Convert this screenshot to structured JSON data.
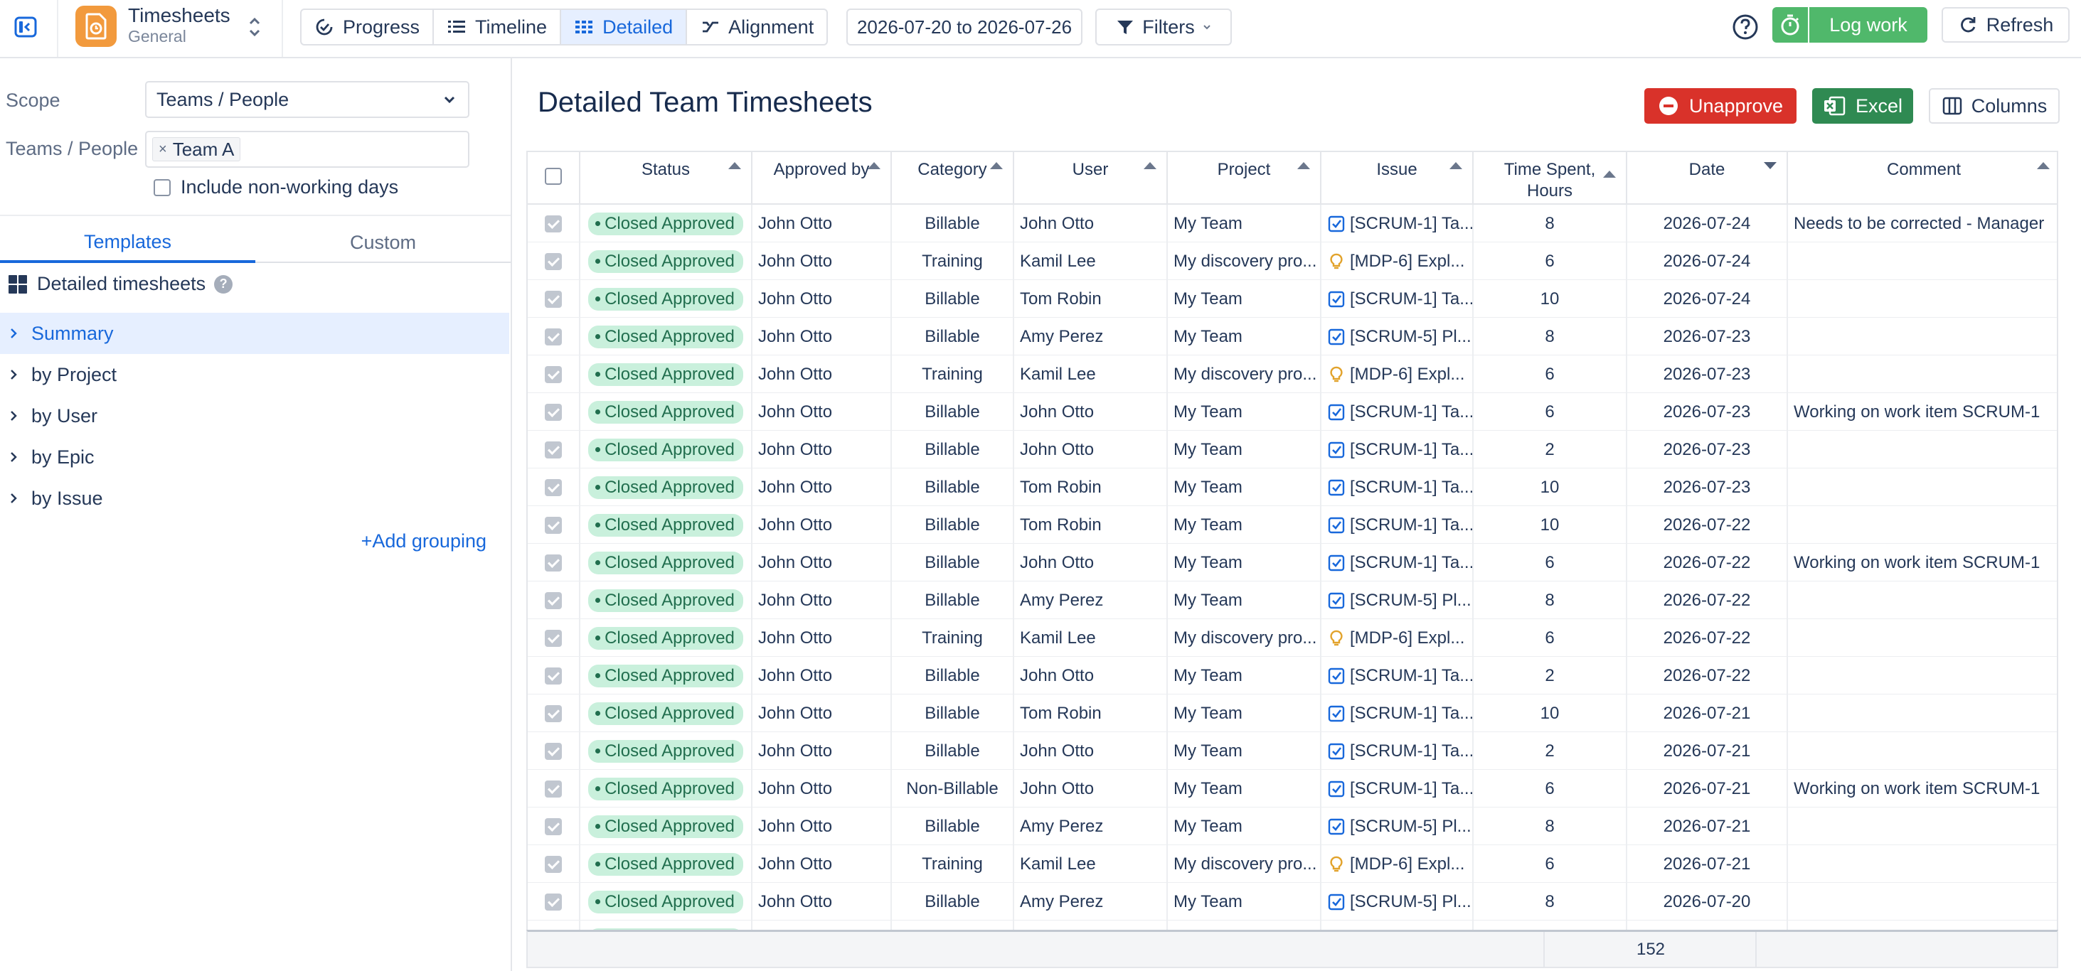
{
  "app": {
    "title": "Timesheets",
    "subtitle": "General"
  },
  "view_tabs": [
    {
      "label": "Progress",
      "icon": "progress-icon",
      "active": false
    },
    {
      "label": "Timeline",
      "icon": "timeline-icon",
      "active": false
    },
    {
      "label": "Detailed",
      "icon": "grid-icon",
      "active": true
    },
    {
      "label": "Alignment",
      "icon": "alignment-icon",
      "active": false
    }
  ],
  "date_range": "2026-07-20 to 2026-07-26",
  "filters_label": "Filters",
  "log_work_label": "Log work",
  "refresh_label": "Refresh",
  "sidebar": {
    "scope_label": "Scope",
    "scope_value": "Teams / People",
    "teams_label": "Teams / People",
    "team_chip": "Team A",
    "chip_remove": "×",
    "non_working_label": "Include non-working days",
    "tabs": [
      "Templates",
      "Custom"
    ],
    "template_title": "Detailed timesheets",
    "help_glyph": "?",
    "tree": [
      "Summary",
      "by Project",
      "by User",
      "by Epic",
      "by Issue"
    ],
    "add_grouping": "+Add grouping"
  },
  "main": {
    "title": "Detailed Team Timesheets",
    "unapprove_label": "Unapprove",
    "excel_label": "Excel",
    "columns_label": "Columns"
  },
  "table": {
    "headers": [
      "Status",
      "Approved by",
      "Category",
      "User",
      "Project",
      "Issue",
      "Time Spent, Hours",
      "Date",
      "Comment"
    ],
    "rows": [
      {
        "status": "Closed Approved",
        "approved_by": "John Otto",
        "category": "Billable",
        "user": "John Otto",
        "project": "My Team",
        "issue_type": "task",
        "issue": "[SCRUM-1] Ta...",
        "hours": "8",
        "date": "2026-07-24",
        "comment": "Needs to be corrected - Manager"
      },
      {
        "status": "Closed Approved",
        "approved_by": "John Otto",
        "category": "Training",
        "user": "Kamil Lee",
        "project": "My discovery pro...",
        "issue_type": "idea",
        "issue": "[MDP-6] Expl...",
        "hours": "6",
        "date": "2026-07-24",
        "comment": ""
      },
      {
        "status": "Closed Approved",
        "approved_by": "John Otto",
        "category": "Billable",
        "user": "Tom Robin",
        "project": "My Team",
        "issue_type": "task",
        "issue": "[SCRUM-1] Ta...",
        "hours": "10",
        "date": "2026-07-24",
        "comment": ""
      },
      {
        "status": "Closed Approved",
        "approved_by": "John Otto",
        "category": "Billable",
        "user": "Amy Perez",
        "project": "My Team",
        "issue_type": "task",
        "issue": "[SCRUM-5] Pl...",
        "hours": "8",
        "date": "2026-07-23",
        "comment": ""
      },
      {
        "status": "Closed Approved",
        "approved_by": "John Otto",
        "category": "Training",
        "user": "Kamil Lee",
        "project": "My discovery pro...",
        "issue_type": "idea",
        "issue": "[MDP-6] Expl...",
        "hours": "6",
        "date": "2026-07-23",
        "comment": ""
      },
      {
        "status": "Closed Approved",
        "approved_by": "John Otto",
        "category": "Billable",
        "user": "John Otto",
        "project": "My Team",
        "issue_type": "task",
        "issue": "[SCRUM-1] Ta...",
        "hours": "6",
        "date": "2026-07-23",
        "comment": "Working on work item SCRUM-1"
      },
      {
        "status": "Closed Approved",
        "approved_by": "John Otto",
        "category": "Billable",
        "user": "John Otto",
        "project": "My Team",
        "issue_type": "task",
        "issue": "[SCRUM-1] Ta...",
        "hours": "2",
        "date": "2026-07-23",
        "comment": ""
      },
      {
        "status": "Closed Approved",
        "approved_by": "John Otto",
        "category": "Billable",
        "user": "Tom Robin",
        "project": "My Team",
        "issue_type": "task",
        "issue": "[SCRUM-1] Ta...",
        "hours": "10",
        "date": "2026-07-23",
        "comment": ""
      },
      {
        "status": "Closed Approved",
        "approved_by": "John Otto",
        "category": "Billable",
        "user": "Tom Robin",
        "project": "My Team",
        "issue_type": "task",
        "issue": "[SCRUM-1] Ta...",
        "hours": "10",
        "date": "2026-07-22",
        "comment": ""
      },
      {
        "status": "Closed Approved",
        "approved_by": "John Otto",
        "category": "Billable",
        "user": "John Otto",
        "project": "My Team",
        "issue_type": "task",
        "issue": "[SCRUM-1] Ta...",
        "hours": "6",
        "date": "2026-07-22",
        "comment": "Working on work item SCRUM-1"
      },
      {
        "status": "Closed Approved",
        "approved_by": "John Otto",
        "category": "Billable",
        "user": "Amy Perez",
        "project": "My Team",
        "issue_type": "task",
        "issue": "[SCRUM-5] Pl...",
        "hours": "8",
        "date": "2026-07-22",
        "comment": ""
      },
      {
        "status": "Closed Approved",
        "approved_by": "John Otto",
        "category": "Training",
        "user": "Kamil Lee",
        "project": "My discovery pro...",
        "issue_type": "idea",
        "issue": "[MDP-6] Expl...",
        "hours": "6",
        "date": "2026-07-22",
        "comment": ""
      },
      {
        "status": "Closed Approved",
        "approved_by": "John Otto",
        "category": "Billable",
        "user": "John Otto",
        "project": "My Team",
        "issue_type": "task",
        "issue": "[SCRUM-1] Ta...",
        "hours": "2",
        "date": "2026-07-22",
        "comment": ""
      },
      {
        "status": "Closed Approved",
        "approved_by": "John Otto",
        "category": "Billable",
        "user": "Tom Robin",
        "project": "My Team",
        "issue_type": "task",
        "issue": "[SCRUM-1] Ta...",
        "hours": "10",
        "date": "2026-07-21",
        "comment": ""
      },
      {
        "status": "Closed Approved",
        "approved_by": "John Otto",
        "category": "Billable",
        "user": "John Otto",
        "project": "My Team",
        "issue_type": "task",
        "issue": "[SCRUM-1] Ta...",
        "hours": "2",
        "date": "2026-07-21",
        "comment": ""
      },
      {
        "status": "Closed Approved",
        "approved_by": "John Otto",
        "category": "Non-Billable",
        "user": "John Otto",
        "project": "My Team",
        "issue_type": "task",
        "issue": "[SCRUM-1] Ta...",
        "hours": "6",
        "date": "2026-07-21",
        "comment": "Working on work item SCRUM-1"
      },
      {
        "status": "Closed Approved",
        "approved_by": "John Otto",
        "category": "Billable",
        "user": "Amy Perez",
        "project": "My Team",
        "issue_type": "task",
        "issue": "[SCRUM-5] Pl...",
        "hours": "8",
        "date": "2026-07-21",
        "comment": ""
      },
      {
        "status": "Closed Approved",
        "approved_by": "John Otto",
        "category": "Training",
        "user": "Kamil Lee",
        "project": "My discovery pro...",
        "issue_type": "idea",
        "issue": "[MDP-6] Expl...",
        "hours": "6",
        "date": "2026-07-21",
        "comment": ""
      },
      {
        "status": "Closed Approved",
        "approved_by": "John Otto",
        "category": "Billable",
        "user": "Amy Perez",
        "project": "My Team",
        "issue_type": "task",
        "issue": "[SCRUM-5] Pl...",
        "hours": "8",
        "date": "2026-07-20",
        "comment": ""
      }
    ],
    "total_hours": "152"
  },
  "colors": {
    "accent": "#1868db",
    "approved_badge": "#c9f0dc",
    "log_work": "#50b86b",
    "unapprove": "#d9322a",
    "excel": "#2f8a52",
    "app_logo": "#f29a3d"
  }
}
